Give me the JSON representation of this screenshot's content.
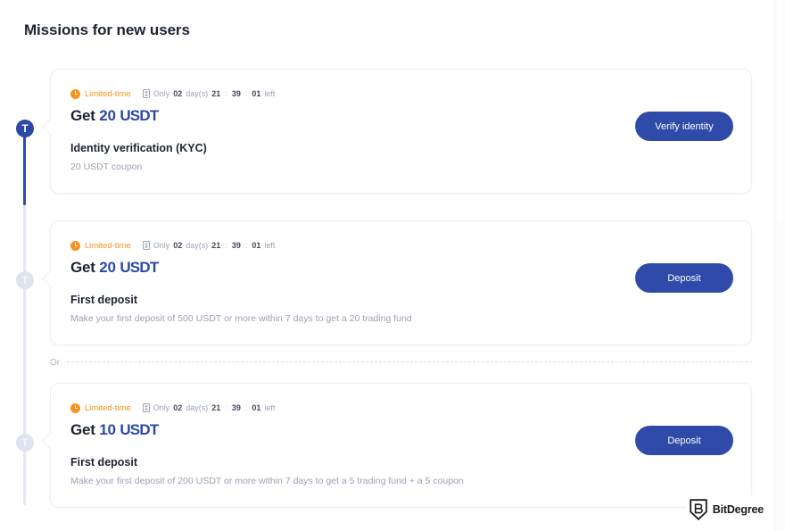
{
  "header": {
    "title": "Missions for new users"
  },
  "colors": {
    "accent_blue": "#2f4aa8",
    "limited_orange": "#f7931e",
    "muted_text": "#9aa2b4",
    "title_text": "#1d2333",
    "rail_inactive": "#e3e8f4"
  },
  "divider": {
    "or_label": "Or"
  },
  "timeline": {
    "nodes": [
      {
        "glyph": "T",
        "state": "active",
        "icon_name": "tether-icon"
      },
      {
        "glyph": "T",
        "state": "inactive",
        "icon_name": "tether-icon"
      },
      {
        "glyph": "T",
        "state": "inactive",
        "icon_name": "tether-icon"
      }
    ]
  },
  "missions": [
    {
      "badge": "Limited-time",
      "countdown": {
        "prefix": "Only",
        "days": "02",
        "days_unit": "day(s)",
        "hours": "21",
        "minutes": "39",
        "seconds": "01",
        "suffix": "left"
      },
      "reward_prefix": "Get",
      "reward_amount": "20",
      "reward_ticker": "USDT",
      "name": "Identity verification (KYC)",
      "description": "20 USDT coupon",
      "button_label": "Verify identity"
    },
    {
      "badge": "Limited-time",
      "countdown": {
        "prefix": "Only",
        "days": "02",
        "days_unit": "day(s)",
        "hours": "21",
        "minutes": "39",
        "seconds": "01",
        "suffix": "left"
      },
      "reward_prefix": "Get",
      "reward_amount": "20",
      "reward_ticker": "USDT",
      "name": "First deposit",
      "description": "Make your first deposit of 500 USDT or more within 7 days to get a 20 trading fund",
      "button_label": "Deposit"
    },
    {
      "badge": "Limited-time",
      "countdown": {
        "prefix": "Only",
        "days": "02",
        "days_unit": "day(s)",
        "hours": "21",
        "minutes": "39",
        "seconds": "01",
        "suffix": "left"
      },
      "reward_prefix": "Get",
      "reward_amount": "10",
      "reward_ticker": "USDT",
      "name": "First deposit",
      "description": "Make your first deposit of 200 USDT or more within 7 days to get a 5 trading fund + a 5 coupon",
      "button_label": "Deposit"
    }
  ],
  "watermark": {
    "text": "BitDegree",
    "logo_letter": "B"
  }
}
